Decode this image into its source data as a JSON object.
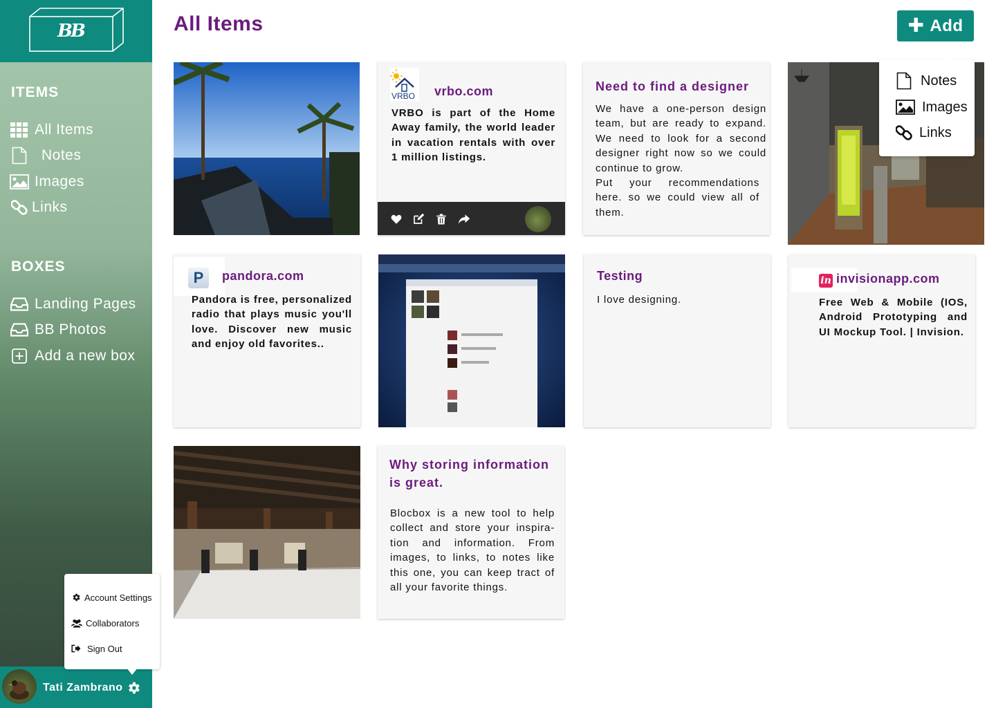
{
  "app": {
    "logo_text": "BB"
  },
  "sidebar": {
    "items_heading": "ITEMS",
    "items": [
      {
        "label": "All Items",
        "icon": "grid-icon"
      },
      {
        "label": "Notes",
        "icon": "document-icon"
      },
      {
        "label": "Images",
        "icon": "image-icon"
      },
      {
        "label": "Links",
        "icon": "link-icon"
      }
    ],
    "boxes_heading": "BOXES",
    "boxes": [
      {
        "label": "Landing Pages",
        "icon": "inbox-icon"
      },
      {
        "label": "BB Photos",
        "icon": "inbox-icon"
      },
      {
        "label": "Add a new box",
        "icon": "plus-square-icon"
      }
    ]
  },
  "user": {
    "name": "Tati  Zambrano",
    "menu": [
      {
        "label": "Account  Settings",
        "icon": "cog-icon"
      },
      {
        "label": "Collaborators",
        "icon": "users-icon"
      },
      {
        "label": "Sign  Out",
        "icon": "sign-out-icon"
      }
    ]
  },
  "header": {
    "title": "All Items",
    "add_label": "Add"
  },
  "add_menu": [
    {
      "label": "Notes",
      "icon": "document-icon"
    },
    {
      "label": "Images",
      "icon": "image-icon"
    },
    {
      "label": "Links",
      "icon": "link-icon"
    }
  ],
  "cards": {
    "vrbo": {
      "title": "vrbo.com",
      "logo_text": "VRBO",
      "body": "VRBO is part of the Home Away family, the world leader in vacation rentals with over 1 million listings."
    },
    "designer": {
      "title": "Need  to  find  a  designer",
      "body": "We have a one-person design team, but are ready to expand. We need to look for a second designer right now so we could continue to grow.",
      "body2": "Put your recommendations here. so we could view all of them."
    },
    "pandora": {
      "title": "pandora.com",
      "logo_text": "P",
      "body": "Pandora is free, personalized radio that plays music you'll love. Discover new music and enjoy old favorites.."
    },
    "testing": {
      "title": "Testing",
      "body": "I  love  designing."
    },
    "invision": {
      "title": "invisionapp.com",
      "logo_text": "in",
      "body": "Free Web & Mobile (IOS, Android Prototyping and UI Mockup Tool. | Invision."
    },
    "storing": {
      "title": "Why  storing  information  is  great.",
      "body": "Blocbox is a new tool to help collect and store your inspira-tion and information. From images, to links, to notes like this one, you can keep tract of all your favorite things."
    }
  },
  "colors": {
    "accent": "#0e8a7f",
    "title_purple": "#6b1b7c",
    "card_bg": "#f6f6f6"
  }
}
